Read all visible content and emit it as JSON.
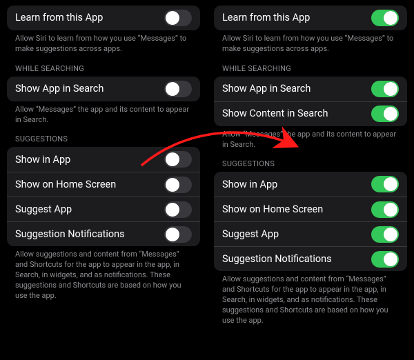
{
  "colors": {
    "accent_on": "#34c759",
    "accent_off": "#39393d",
    "cell_bg": "#1c1c1e",
    "footer_text": "#8e8e93",
    "arrow": "#ff1a1a"
  },
  "left": {
    "learn": {
      "label": "Learn from this App",
      "footer": "Allow Siri to learn from how you use “Messages” to make suggestions across apps.",
      "on": false
    },
    "searching": {
      "header": "WHILE SEARCHING",
      "rows": [
        {
          "label": "Show App in Search",
          "on": false
        }
      ],
      "footer": "Allow “Messages” the app and its content to appear in Search."
    },
    "suggestions": {
      "header": "SUGGESTIONS",
      "rows": [
        {
          "label": "Show in App",
          "on": false
        },
        {
          "label": "Show on Home Screen",
          "on": false
        },
        {
          "label": "Suggest App",
          "on": false
        },
        {
          "label": "Suggestion Notifications",
          "on": false
        }
      ],
      "footer": "Allow suggestions and content from “Messages” and Shortcuts for the app to appear in the app, in Search, in widgets, and as notifications. These suggestions and Shortcuts are based on how you use the app."
    }
  },
  "right": {
    "learn": {
      "label": "Learn from this App",
      "footer": "Allow Siri to learn from how you use “Messages” to make suggestions across apps.",
      "on": true
    },
    "searching": {
      "header": "WHILE SEARCHING",
      "rows": [
        {
          "label": "Show App in Search",
          "on": true
        },
        {
          "label": "Show Content in Search",
          "on": true
        }
      ],
      "footer": "Allow “Messages” the app and its content to appear in Search."
    },
    "suggestions": {
      "header": "SUGGESTIONS",
      "rows": [
        {
          "label": "Show in App",
          "on": true
        },
        {
          "label": "Show on Home Screen",
          "on": true
        },
        {
          "label": "Suggest App",
          "on": true
        },
        {
          "label": "Suggestion Notifications",
          "on": true
        }
      ],
      "footer": "Allow suggestions and content from “Messages” and Shortcuts for the app to appear in the app, in Search, in widgets, and as notifications. These suggestions and Shortcuts are based on how you use the app."
    }
  }
}
